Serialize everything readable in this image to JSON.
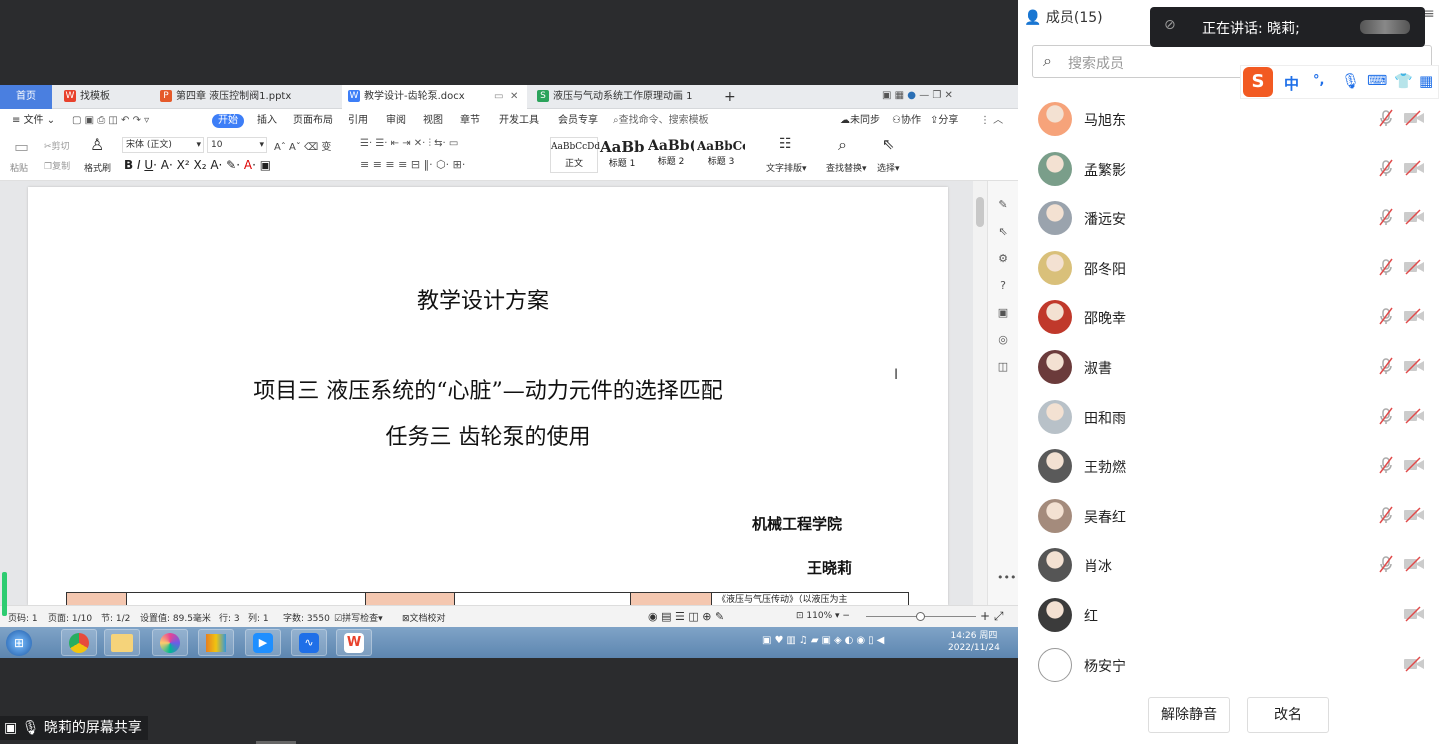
{
  "wps": {
    "tabs": [
      {
        "label": "首页",
        "type": "home"
      },
      {
        "label": "找模板",
        "type": "wps"
      },
      {
        "label": "第四章 液压控制阀1.pptx",
        "type": "ppt"
      },
      {
        "label": "教学设计-齿轮泵.docx",
        "type": "doc"
      },
      {
        "label": "液压与气动系统工作原理动画 1",
        "type": "sheet"
      }
    ],
    "add_tab": "+",
    "menu": [
      "文件",
      "开始",
      "插入",
      "页面布局",
      "引用",
      "审阅",
      "视图",
      "章节",
      "开发工具",
      "会员专享"
    ],
    "search_placeholder": "查找命令、搜索模板",
    "sync": "未同步",
    "collab": "协作",
    "share": "分享",
    "ribbon": {
      "paste": "粘贴",
      "cut": "剪切",
      "copy": "复制",
      "format_painter": "格式刷",
      "font": "宋体 (正文)",
      "size": "10",
      "styles": [
        {
          "sample": "AaBbCcDd",
          "name": "正文"
        },
        {
          "sample": "AaBb",
          "name": "标题 1"
        },
        {
          "sample": "AaBb(",
          "name": "标题 2"
        },
        {
          "sample": "AaBbCc",
          "name": "标题 3"
        }
      ],
      "text_layout": "文字排版",
      "find_replace": "查找替换",
      "select": "选择"
    },
    "doc": {
      "title": "教学设计方案",
      "line1": "项目三  液压系统的“心脏”—动力元件的选择匹配",
      "line2": "任务三  齿轮泵的使用",
      "college": "机械工程学院",
      "author": "王晓莉",
      "table_partial": "《液压与气压传动》（以液压为主"
    },
    "status": {
      "page_num": "页码: 1",
      "pages": "页面: 1/10",
      "section": "节: 1/2",
      "setting": "设置值: 89.5毫米",
      "row": "行: 3",
      "col": "列: 1",
      "words": "字数: 3550",
      "spell": "拼写检查",
      "proof": "文档校对",
      "zoom": "110%"
    }
  },
  "taskbar": {
    "time": "14:26 周四",
    "date": "2022/11/24"
  },
  "share_label": "晓莉的屏幕共享",
  "panel": {
    "members_title": "成员(15)",
    "search_placeholder": "搜索成员",
    "speaking": "正在讲话: 晓莉;",
    "ime": {
      "lang": "中",
      "punct": "°,"
    },
    "members": [
      {
        "name": "马旭东",
        "mic": true,
        "color": "#f6a37a"
      },
      {
        "name": "孟繁影",
        "mic": true,
        "color": "#7a9e8a"
      },
      {
        "name": "潘远安",
        "mic": true,
        "color": "#9aa3ad"
      },
      {
        "name": "邵冬阳",
        "mic": true,
        "color": "#d9c07a"
      },
      {
        "name": "邵晚幸",
        "mic": true,
        "color": "#c0392b"
      },
      {
        "name": "淑書",
        "mic": true,
        "color": "#6b3b3b"
      },
      {
        "name": "田和雨",
        "mic": true,
        "color": "#b8c1c8"
      },
      {
        "name": "王勃燃",
        "mic": true,
        "color": "#5a5a5a"
      },
      {
        "name": "吴春红",
        "mic": true,
        "color": "#a48b7c"
      },
      {
        "name": "肖冰",
        "mic": true,
        "color": "#555555"
      },
      {
        "name": "红",
        "mic": false,
        "color": "#3b3b3b"
      },
      {
        "name": "杨安宁",
        "mic": false,
        "color": "#ffffff"
      }
    ],
    "unmute_btn": "解除静音",
    "rename_btn": "改名"
  }
}
